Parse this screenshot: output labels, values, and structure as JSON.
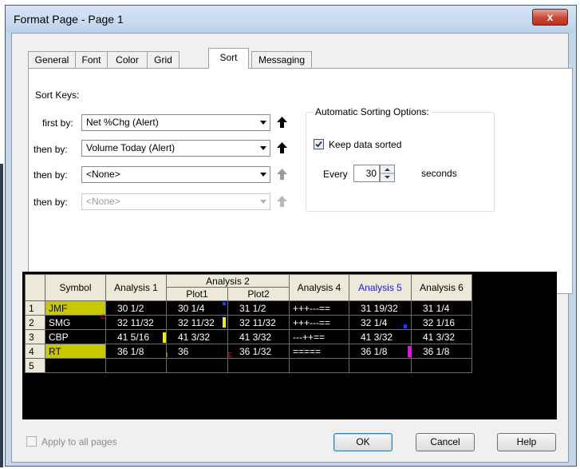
{
  "window": {
    "title": "Format Page - Page 1",
    "close_glyph": "x"
  },
  "tabs": [
    "General",
    "Font",
    "Color",
    "Grid",
    "Sort",
    "Messaging"
  ],
  "active_tab": "Sort",
  "sort_keys": {
    "heading": "Sort Keys:",
    "rows": [
      {
        "label": "first by:",
        "value": "Net %Chg (Alert)",
        "enabled": true
      },
      {
        "label": "then by:",
        "value": "Volume Today (Alert)",
        "enabled": true
      },
      {
        "label": "then by:",
        "value": "<None>",
        "enabled": true
      },
      {
        "label": "then by:",
        "value": "<None>",
        "enabled": false
      }
    ]
  },
  "auto_sort": {
    "title": "Automatic Sorting Options:",
    "keep_sorted_label": "Keep data sorted",
    "keep_sorted_checked": true,
    "every_label": "Every",
    "interval": "30",
    "seconds_label": "seconds"
  },
  "preview_grid": {
    "headers": {
      "symbol": "Symbol",
      "analysis1": "Analysis 1",
      "analysis2": "Analysis 2",
      "plot1": "Plot1",
      "plot2": "Plot2",
      "analysis4": "Analysis 4",
      "analysis5": "Analysis 5",
      "analysis6": "Analysis 6"
    },
    "rows": [
      {
        "num": "1",
        "symbol": "JMF",
        "a1": "30  1/2",
        "p1": "30  1/4",
        "p2": "31  1/2",
        "a4": "+++---==",
        "a5": "31  19/32",
        "a6": "31  1/4"
      },
      {
        "num": "2",
        "symbol": "SMG",
        "a1": "32  11/32",
        "p1": "32  11/32",
        "p2": "32  11/32",
        "a4": "+++---==",
        "a5": "32  1/4",
        "a6": "32  1/16"
      },
      {
        "num": "3",
        "symbol": "CBP",
        "a1": "41  5/16",
        "p1": "41  3/32",
        "p2": "41  3/32",
        "a4": "---++==",
        "a5": "41  3/32",
        "a6": "41  3/32"
      },
      {
        "num": "4",
        "symbol": "RT",
        "a1": "36  1/8",
        "p1": "36",
        "p2": "36  1/32",
        "a4": "=====",
        "a5": "36  1/8",
        "a6": "36  1/8"
      },
      {
        "num": "5",
        "symbol": "",
        "a1": "",
        "p1": "",
        "p2": "",
        "a4": "",
        "a5": "",
        "a6": ""
      }
    ],
    "marks": {
      "c": "C",
      "i": "I",
      "e": "E"
    }
  },
  "footer": {
    "apply_all_label": "Apply to all pages",
    "ok_label": "OK",
    "cancel_label": "Cancel",
    "help_label": "Help"
  },
  "colors": {
    "highlight_yellow": "#c8c800",
    "analysis5_header": "#1a1ae6",
    "magenta_mark": "#ff00ff",
    "grid_bg": "#000000"
  }
}
